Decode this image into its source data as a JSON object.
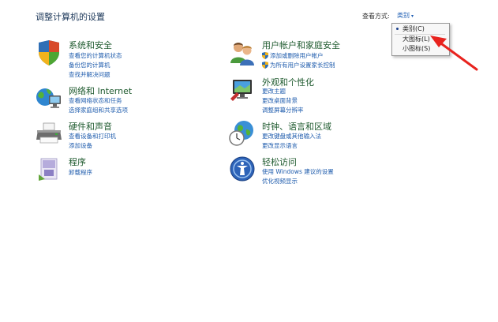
{
  "header": {
    "title": "调整计算机的设置",
    "view_by_label": "查看方式:",
    "view_by_value": "类别"
  },
  "view_menu": {
    "items": [
      {
        "label": "类别(C)",
        "selected": true
      },
      {
        "label": "大图标(L)",
        "selected": false
      },
      {
        "label": "小图标(S)",
        "selected": false
      }
    ]
  },
  "annotation": {
    "arrow_color": "#e8231e"
  },
  "categories_left": [
    {
      "title": "系统和安全",
      "icon": "system-security-icon",
      "links": [
        "查看您的计算机状态",
        "备份您的计算机",
        "查找并解决问题"
      ]
    },
    {
      "title": "网络和 Internet",
      "icon": "network-icon",
      "links": [
        "查看网络状态和任务",
        "选择家庭组和共享选项"
      ]
    },
    {
      "title": "硬件和声音",
      "icon": "printer-icon",
      "links": [
        "查看设备和打印机",
        "添加设备"
      ]
    },
    {
      "title": "程序",
      "icon": "programs-icon",
      "links": [
        "卸载程序"
      ]
    }
  ],
  "categories_right": [
    {
      "title": "用户帐户和家庭安全",
      "icon": "users-icon",
      "links": [
        "添加或删除用户帐户",
        "为所有用户设置家长控制"
      ],
      "shielded": [
        true,
        true
      ]
    },
    {
      "title": "外观和个性化",
      "icon": "appearance-icon",
      "links": [
        "更改主题",
        "更改桌面背景",
        "调整屏幕分辨率"
      ]
    },
    {
      "title": "时钟、语言和区域",
      "icon": "clock-globe-icon",
      "links": [
        "更改键盘或其他输入法",
        "更改显示语言"
      ]
    },
    {
      "title": "轻松访问",
      "icon": "ease-of-access-icon",
      "links": [
        "使用 Windows 建议的设置",
        "优化视频显示"
      ]
    }
  ]
}
